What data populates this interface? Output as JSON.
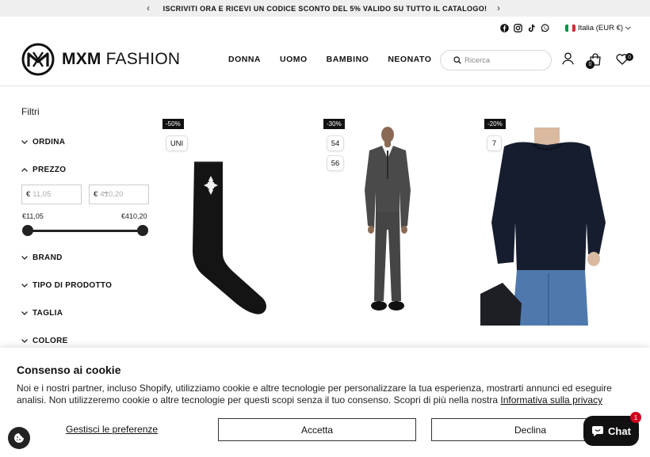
{
  "announcement": {
    "text": "ISCRIVITI ORA E RICEVI UN CODICE SCONTO DEL 5% VALIDO SU TUTTO IL CATALOGO!",
    "prev_icon": "chevron-left-icon",
    "next_icon": "chevron-right-icon"
  },
  "utility": {
    "social_icons": [
      "facebook-icon",
      "instagram-icon",
      "tiktok-icon",
      "whatsapp-icon"
    ],
    "locale": "Italia (EUR €)",
    "locale_flag_colors": [
      "#009246",
      "#ffffff",
      "#ce2b37"
    ]
  },
  "header": {
    "logo_bold": "MXM",
    "logo_light": "FASHION",
    "nav": [
      "DONNA",
      "UOMO",
      "BAMBINO",
      "NEONATO"
    ],
    "search_placeholder": "Ricerca",
    "cart_count": "0",
    "wishlist_count": "0"
  },
  "filters": {
    "title": "Filtri",
    "facets": {
      "ordina": "ORDINA",
      "prezzo": "PREZZO",
      "brand": "BRAND",
      "tipo": "TIPO DI PRODOTTO",
      "taglia": "TAGLIA",
      "colore": "COLORE"
    },
    "currency": "€",
    "price_min_placeholder": "11,05",
    "price_max_placeholder": "410,20",
    "range_min_label": "€11,05",
    "range_max_label": "€410,20"
  },
  "products": [
    {
      "discount": "-50%",
      "sizes": [
        "UNI"
      ],
      "image": "black-sock-image"
    },
    {
      "discount": "-30%",
      "sizes": [
        "54",
        "56"
      ],
      "image": "grey-suit-image"
    },
    {
      "discount": "-20%",
      "sizes": [
        "7"
      ],
      "image": "navy-sweater-image"
    }
  ],
  "cookie": {
    "title": "Consenso ai cookie",
    "text": "Noi e i nostri partner, incluso Shopify, utilizziamo cookie e altre tecnologie per personalizzare la tua esperienza, mostrarti annunci ed eseguire analisi. Non utilizzeremo cookie o altre tecnologie per questi scopi senza il tuo consenso. Scopri di più nella nostra",
    "privacy_link": "Informativa sulla privacy",
    "manage_label": "Gestisci le preferenze",
    "accept_label": "Accetta",
    "decline_label": "Declina"
  },
  "chat": {
    "label": "Chat",
    "badge": "1"
  },
  "colors": {
    "accent": "#111111",
    "chat_badge": "#d0021b",
    "announcement_bg": "#efefef"
  }
}
